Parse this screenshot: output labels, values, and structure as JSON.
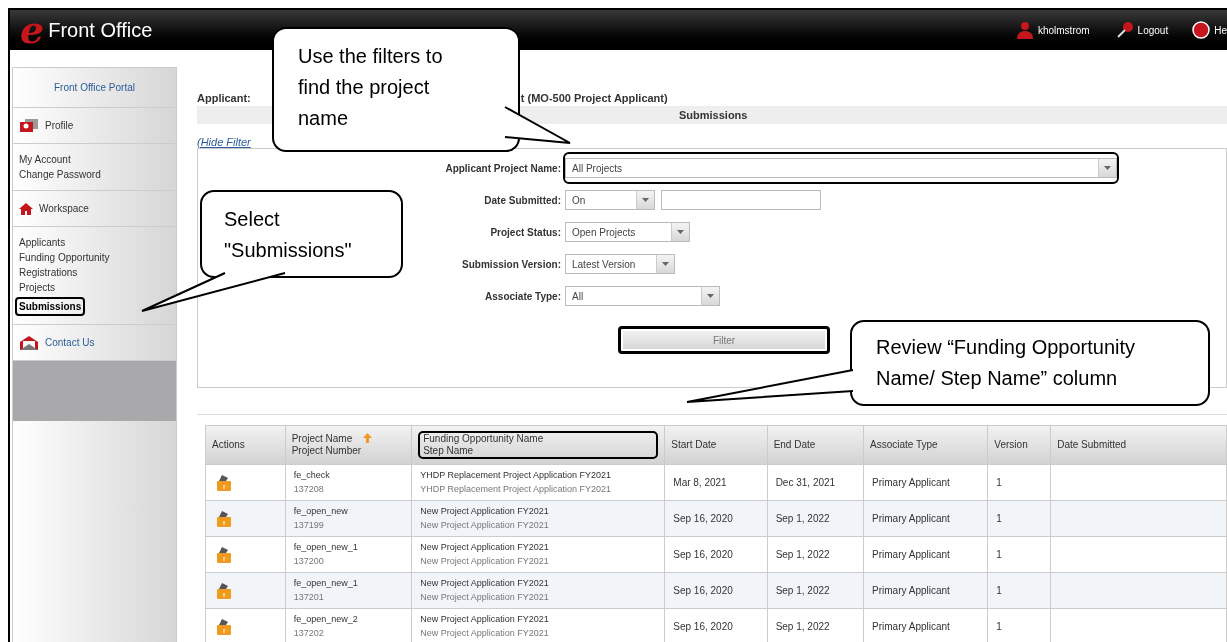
{
  "header": {
    "logo_mark": "e",
    "title": "Front Office",
    "user": "kholmstrom",
    "logout": "Logout",
    "help": "He"
  },
  "sidebar": {
    "portal_link": "Front Office Portal",
    "sections": [
      {
        "kind": "heading",
        "title": "Profile",
        "links": [
          {
            "label": "My Account",
            "selected": false,
            "highlighted": false
          },
          {
            "label": "Change Password",
            "selected": false,
            "highlighted": false
          }
        ]
      },
      {
        "kind": "heading",
        "title": "Workspace",
        "links": [
          {
            "label": "Applicants",
            "selected": false,
            "highlighted": false
          },
          {
            "label": "Funding Opportunity Registrations",
            "selected": false,
            "highlighted": false
          },
          {
            "label": "Projects",
            "selected": false,
            "highlighted": false
          },
          {
            "label": "Submissions",
            "selected": true,
            "highlighted": true
          }
        ]
      },
      {
        "kind": "link",
        "title": "Contact Us"
      }
    ]
  },
  "page": {
    "title_start": "Applicant:",
    "title_end": "t (MO-500 Project Applicant)",
    "subtitle": "Submissions",
    "filter_toggle": "(Hide Filter"
  },
  "filters": [
    {
      "kind": "select",
      "label": "Applicant Project Name:",
      "value": "All Projects",
      "highlighted": true
    },
    {
      "kind": "select_date",
      "label": "Date Submitted:",
      "value": "On",
      "highlighted": false
    },
    {
      "kind": "select",
      "label": "Project Status:",
      "value": "Open Projects",
      "highlighted": false
    },
    {
      "kind": "select",
      "label": "Submission Version:",
      "value": "Latest Version",
      "highlighted": false
    },
    {
      "kind": "select",
      "label": "Associate Type:",
      "value": "All",
      "highlighted": false
    }
  ],
  "filter_button": {
    "label": "Filter",
    "highlighted": true
  },
  "table": {
    "columns": [
      {
        "label": "Actions",
        "sorted": false,
        "highlighted": false
      },
      {
        "label": "Project Name",
        "label_2": "Project Number",
        "sorted": true,
        "highlighted": false
      },
      {
        "label": "Funding Opportunity Name",
        "label_2": "Step Name",
        "sorted": false,
        "highlighted": true
      },
      {
        "label": "Start Date",
        "sorted": false,
        "highlighted": false
      },
      {
        "label": "End Date",
        "sorted": false,
        "highlighted": false
      },
      {
        "label": "Associate Type",
        "sorted": false,
        "highlighted": false
      },
      {
        "label": "Version",
        "sorted": false,
        "highlighted": false
      },
      {
        "label": "Date Submitted",
        "sorted": false,
        "highlighted": false
      }
    ],
    "rows": [
      {
        "project_name": "fe_check",
        "project_number": "137208",
        "funding_name": "YHDP Replacement Project Application FY2021",
        "step_name": "YHDP Replacement Project Application FY2021",
        "start_date": "Mar 8, 2021",
        "end_date": "Dec 31, 2021",
        "associate_type": "Primary Applicant",
        "version": "1"
      },
      {
        "project_name": "fe_open_new",
        "project_number": "137199",
        "funding_name": "New Project Application FY2021",
        "step_name": "New Project Application FY2021",
        "start_date": "Sep 16, 2020",
        "end_date": "Sep 1, 2022",
        "associate_type": "Primary Applicant",
        "version": "1"
      },
      {
        "project_name": "fe_open_new_1",
        "project_number": "137200",
        "funding_name": "New Project Application FY2021",
        "step_name": "New Project Application FY2021",
        "start_date": "Sep 16, 2020",
        "end_date": "Sep 1, 2022",
        "associate_type": "Primary Applicant",
        "version": "1"
      },
      {
        "project_name": "fe_open_new_1",
        "project_number": "137201",
        "funding_name": "New Project Application FY2021",
        "step_name": "New Project Application FY2021",
        "start_date": "Sep 16, 2020",
        "end_date": "Sep 1, 2022",
        "associate_type": "Primary Applicant",
        "version": "1"
      },
      {
        "project_name": "fe_open_new_2",
        "project_number": "137202",
        "funding_name": "New Project Application FY2021",
        "step_name": "New Project Application FY2021",
        "start_date": "Sep 16, 2020",
        "end_date": "Sep 1, 2022",
        "associate_type": "Primary Applicant",
        "version": "1"
      }
    ]
  },
  "callouts": [
    {
      "text": "Use the filters to find the project name"
    },
    {
      "text": "Select \"Submissions\""
    },
    {
      "text": "Review “Funding Opportunity Name/ Step Name” column"
    }
  ]
}
